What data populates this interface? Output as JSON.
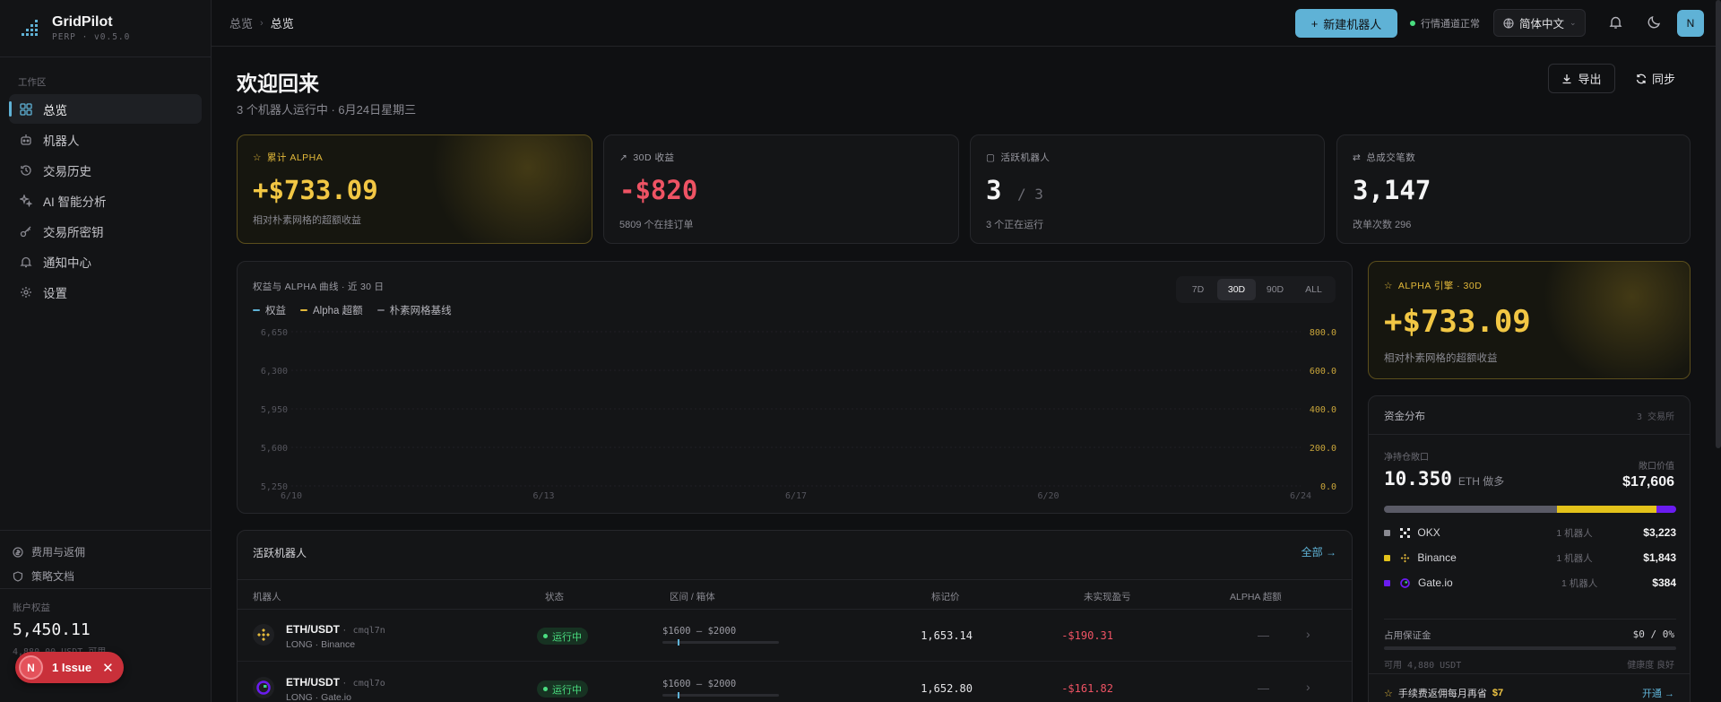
{
  "app": {
    "name": "GridPilot",
    "tagline": "PERP · v0.5.0"
  },
  "sidebar": {
    "section_label": "工作区",
    "items": [
      {
        "label": "总览",
        "icon": "grid-icon",
        "active": true
      },
      {
        "label": "机器人",
        "icon": "robot-icon"
      },
      {
        "label": "交易历史",
        "icon": "history-icon"
      },
      {
        "label": "AI 智能分析",
        "icon": "sparkle-icon"
      },
      {
        "label": "交易所密钥",
        "icon": "key-icon"
      },
      {
        "label": "通知中心",
        "icon": "bell-icon"
      },
      {
        "label": "设置",
        "icon": "gear-icon"
      }
    ],
    "footer_links": [
      {
        "label": "费用与返佣"
      },
      {
        "label": "策略文档"
      }
    ],
    "account": {
      "label": "账户权益",
      "value": "5,450.11",
      "sub": "4,880.00 USDT 可用"
    }
  },
  "issue_badge": {
    "letter": "N",
    "label": "1 Issue"
  },
  "topbar": {
    "breadcrumb": [
      "总览",
      "总览"
    ],
    "new_bot_label": "新建机器人",
    "status": "行情通道正常",
    "language": "简体中文",
    "avatar": "N"
  },
  "header": {
    "title": "欢迎回来",
    "subtitle": "3 个机器人运行中 · 6月24日星期三",
    "export_label": "导出",
    "sync_label": "同步"
  },
  "stats": [
    {
      "label": "累计 ALPHA",
      "value": "+$733.09",
      "sub": "相对朴素网格的超额收益"
    },
    {
      "label": "30D 收益",
      "value": "-$820",
      "sub": "5809 个在挂订单"
    },
    {
      "label": "活跃机器人",
      "value": "3",
      "value_total": "/ 3",
      "sub": "3 个正在运行"
    },
    {
      "label": "总成交笔数",
      "value": "3,147",
      "sub": "改单次数 296"
    }
  ],
  "chart": {
    "title": "权益与 ALPHA 曲线 · 近 30 日",
    "legend": [
      {
        "name": "权益",
        "color": "#5fb2d6"
      },
      {
        "name": "Alpha 超额",
        "color": "#e3b93a"
      },
      {
        "name": "朴素网格基线",
        "color": "#6b6b73"
      }
    ],
    "ranges": [
      "7D",
      "30D",
      "90D",
      "ALL"
    ],
    "active_range": "30D"
  },
  "chart_data": {
    "type": "line",
    "title": "权益与 ALPHA 曲线 · 近 30 日",
    "x_ticks": [
      "6/10",
      "6/13",
      "6/17",
      "6/20",
      "6/24"
    ],
    "y_left_ticks": [
      "6,650",
      "6,300",
      "5,950",
      "5,600",
      "5,250"
    ],
    "y_left_range": [
      5250,
      6650
    ],
    "y_right_ticks": [
      "800.0",
      "600.0",
      "400.0",
      "200.0",
      "0.0"
    ],
    "y_right_range": [
      0,
      800
    ],
    "series": [
      {
        "name": "权益",
        "values": []
      },
      {
        "name": "Alpha 超额",
        "values": []
      },
      {
        "name": "朴素网格基线",
        "values": []
      }
    ],
    "grid": true,
    "legend_position": "top-left"
  },
  "bots_table": {
    "title": "活跃机器人",
    "all_label": "全部 →",
    "columns": [
      "机器人",
      "状态",
      "区间 / 箱体",
      "标记价",
      "未实现盈亏",
      "ALPHA 超额"
    ],
    "rows": [
      {
        "pair": "ETH/USDT",
        "id": "cmql7n",
        "sub": "LONG · Binance",
        "status": "运行中",
        "range": "$1600 — $2000",
        "range_pos": 0.13,
        "mark": "1,653.14",
        "pnl": "-$190.31",
        "alpha": "—",
        "exchange": "binance"
      },
      {
        "pair": "ETH/USDT",
        "id": "cmql7o",
        "sub": "LONG · Gate.io",
        "status": "运行中",
        "range": "$1600 — $2000",
        "range_pos": 0.13,
        "mark": "1,652.80",
        "pnl": "-$161.82",
        "alpha": "—",
        "exchange": "gate"
      }
    ]
  },
  "alpha_card": {
    "label": "ALPHA 引擎 · 30D",
    "value": "+$733.09",
    "sub": "相对朴素网格的超额收益"
  },
  "allocation": {
    "title": "资金分布",
    "count": "3 交易所",
    "net_label": "净持仓敞口",
    "net_value": "10.350",
    "net_unit": "ETH 做多",
    "exposure_label": "敞口价值",
    "exposure_value": "$17,606",
    "bar": [
      {
        "share": 0.593,
        "color": "#5a5a66"
      },
      {
        "share": 0.339,
        "color": "#e3c21a"
      },
      {
        "share": 0.068,
        "color": "#6a1cf0"
      }
    ],
    "exchanges": [
      {
        "name": "OKX",
        "bots": "1 机器人",
        "value": "$3,223",
        "color": "#8a8a92",
        "icon": "okx-icon"
      },
      {
        "name": "Binance",
        "bots": "1 机器人",
        "value": "$1,843",
        "color": "#e3c21a",
        "icon": "binance-icon"
      },
      {
        "name": "Gate.io",
        "bots": "1 机器人",
        "value": "$384",
        "color": "#6a1cf0",
        "icon": "gate-icon"
      }
    ],
    "margin_label": "占用保证金",
    "margin_value": "$0 / 0%",
    "margin_share": 0,
    "available": "可用 4,880 USDT",
    "health": "健康度 良好"
  },
  "promo": {
    "text": "手续费返佣每月再省",
    "amount": "$7",
    "action": "开通 →"
  }
}
